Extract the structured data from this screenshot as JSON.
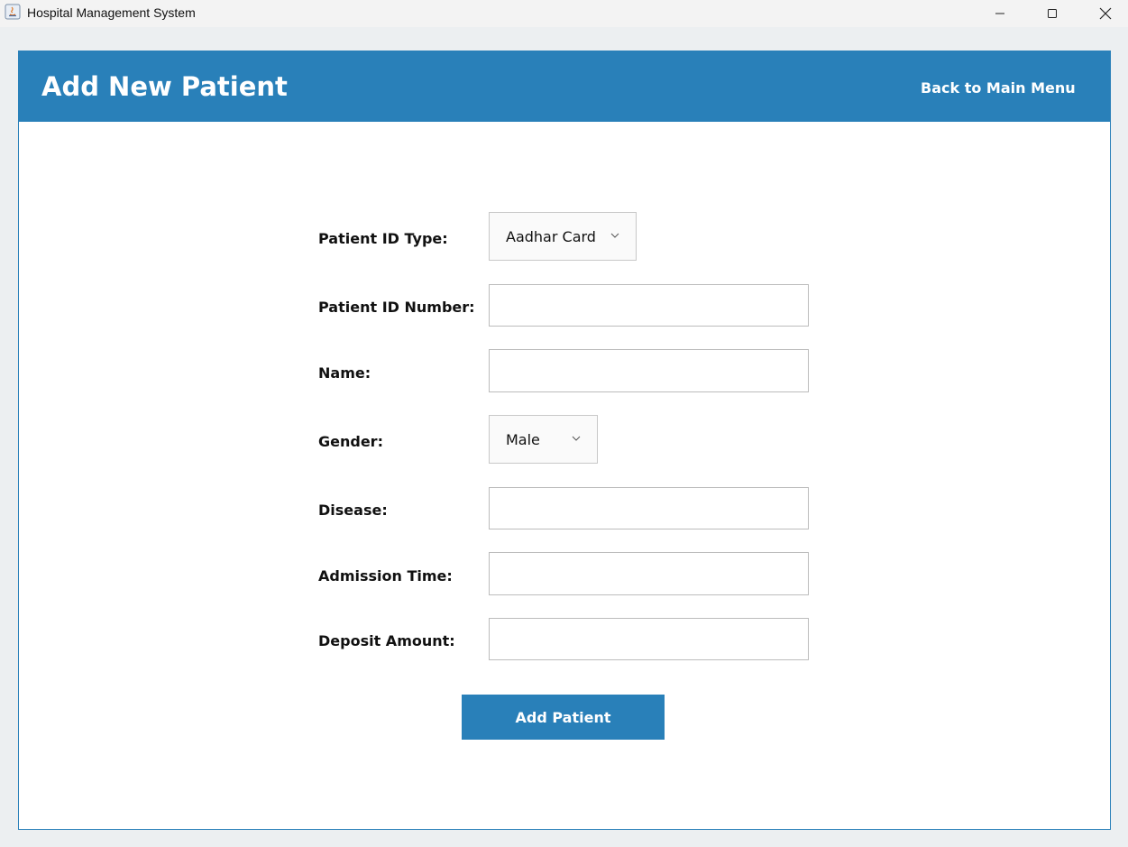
{
  "window": {
    "title": "Hospital Management System",
    "icons": {
      "app": "java-app-icon",
      "minimize": "minimize-icon",
      "maximize": "maximize-icon",
      "close": "close-icon"
    }
  },
  "header": {
    "title": "Add New Patient",
    "back_label": "Back to Main Menu",
    "color": "#2980b9"
  },
  "form": {
    "id_type": {
      "label": "Patient ID Type:",
      "selected": "Aadhar Card"
    },
    "id_number": {
      "label": "Patient ID Number:",
      "value": ""
    },
    "name": {
      "label": "Name:",
      "value": ""
    },
    "gender": {
      "label": "Gender:",
      "selected": "Male"
    },
    "disease": {
      "label": "Disease:",
      "value": ""
    },
    "admission_time": {
      "label": "Admission Time:",
      "value": ""
    },
    "deposit_amount": {
      "label": "Deposit Amount:",
      "value": ""
    },
    "submit_label": "Add Patient"
  }
}
